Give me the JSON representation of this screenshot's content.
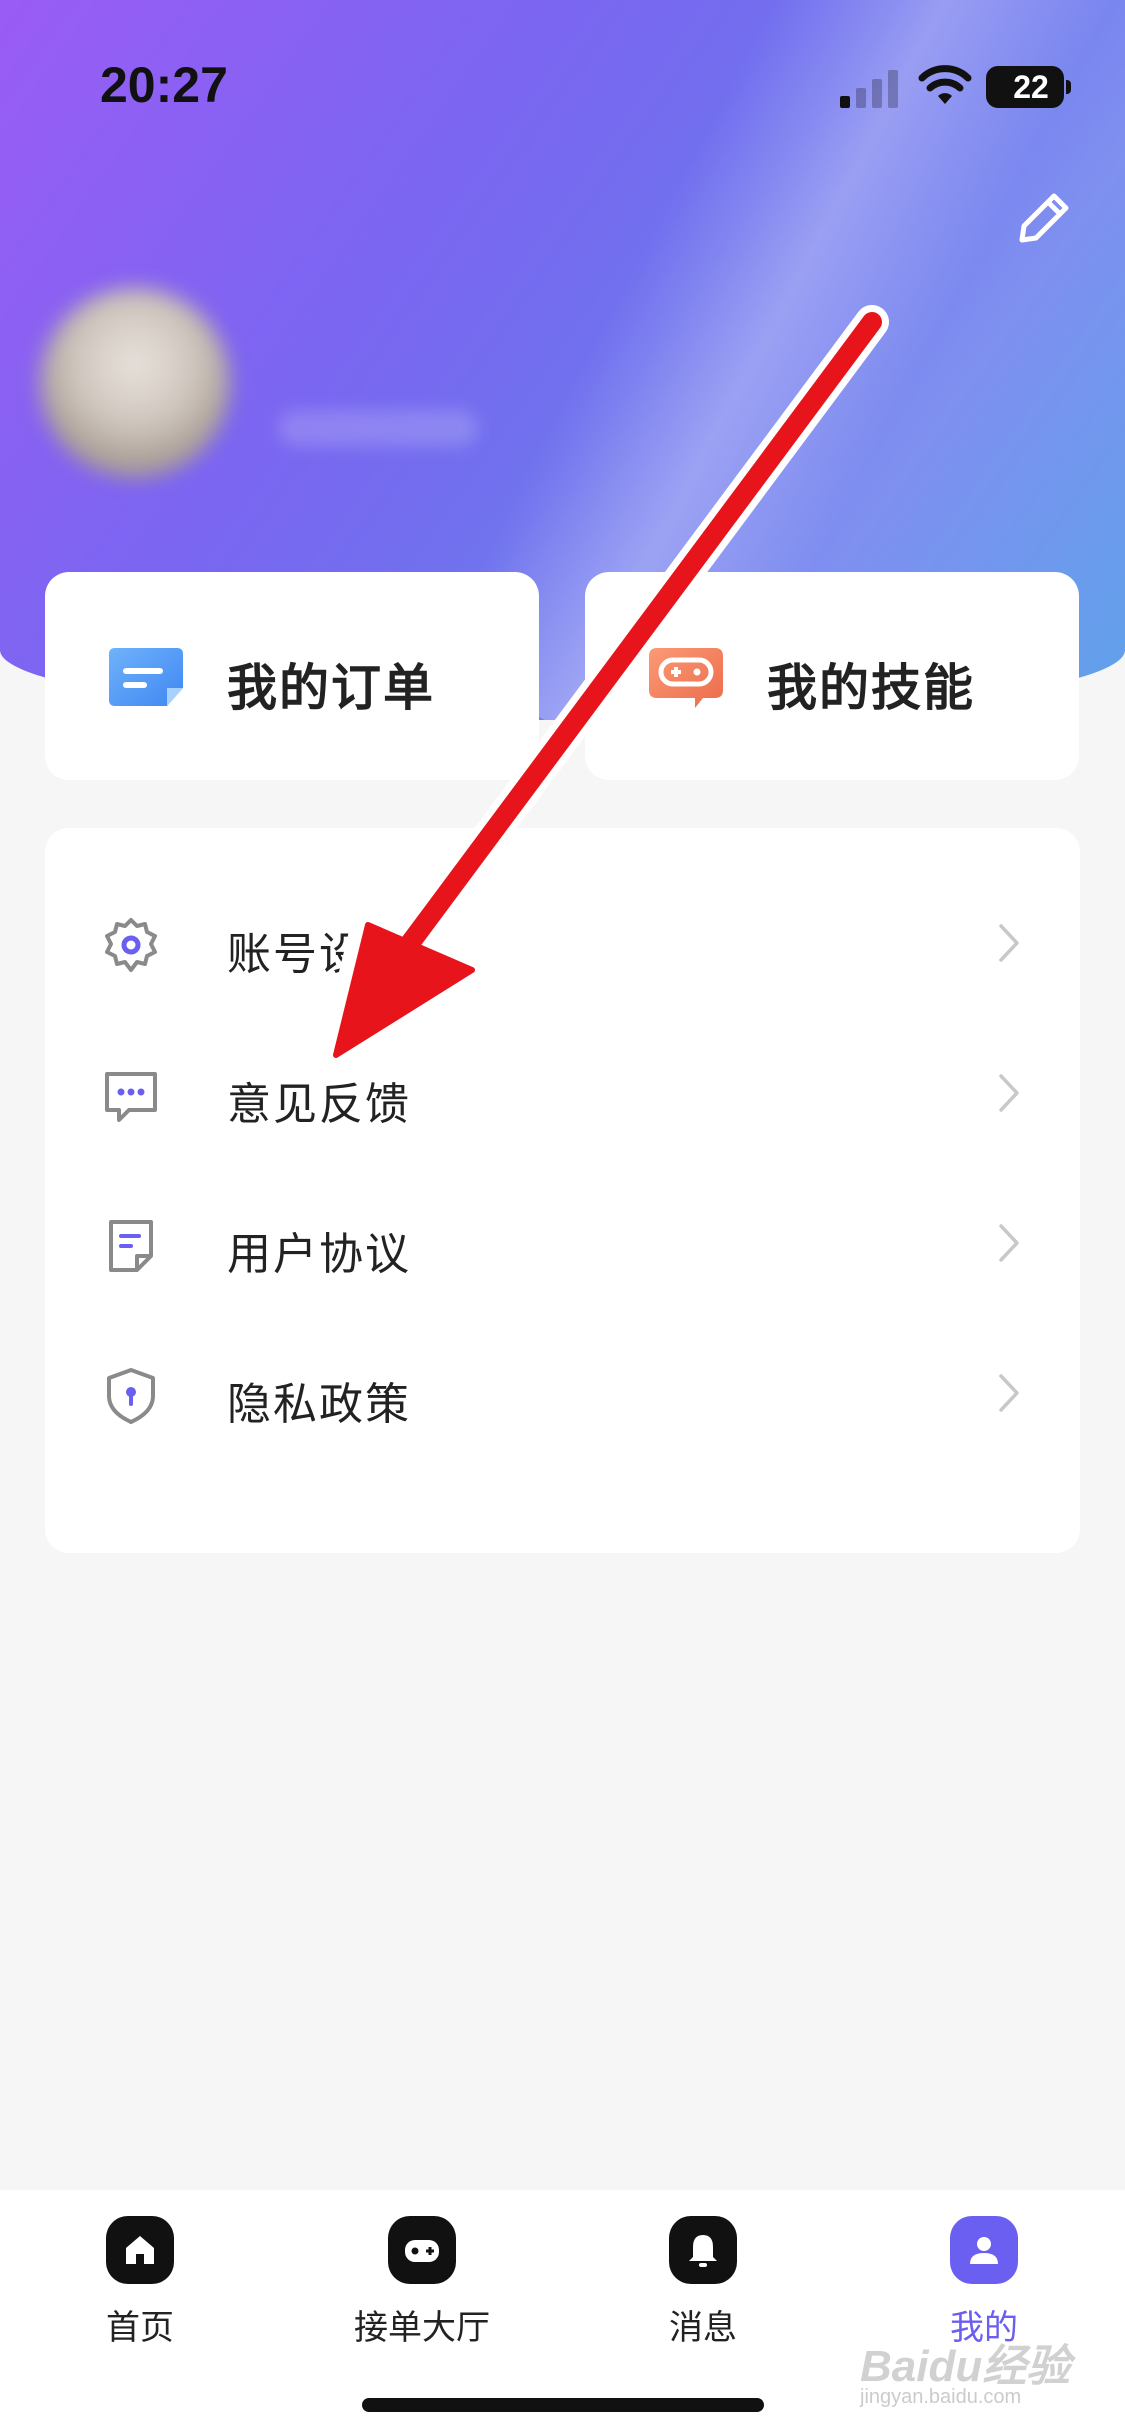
{
  "status_bar": {
    "time": "20:27",
    "battery": "22"
  },
  "quick_cards": [
    {
      "label": "我的订单",
      "icon": "order-icon"
    },
    {
      "label": "我的技能",
      "icon": "gamepad-icon"
    }
  ],
  "menu": {
    "items": [
      {
        "label": "账号设置",
        "icon": "gear-icon"
      },
      {
        "label": "意见反馈",
        "icon": "feedback-icon"
      },
      {
        "label": "用户协议",
        "icon": "document-icon"
      },
      {
        "label": "隐私政策",
        "icon": "shield-icon"
      }
    ]
  },
  "tabbar": {
    "items": [
      {
        "label": "首页",
        "icon": "home-icon",
        "active": false
      },
      {
        "label": "接单大厅",
        "icon": "gamepad-icon",
        "active": false
      },
      {
        "label": "消息",
        "icon": "bell-icon",
        "active": false
      },
      {
        "label": "我的",
        "icon": "user-icon",
        "active": true
      }
    ]
  },
  "watermark": {
    "text": "Baidu经验",
    "sub": "jingyan.baidu.com"
  },
  "colors": {
    "accent": "#6a5ff0",
    "annotation_arrow": "#e8141b"
  }
}
